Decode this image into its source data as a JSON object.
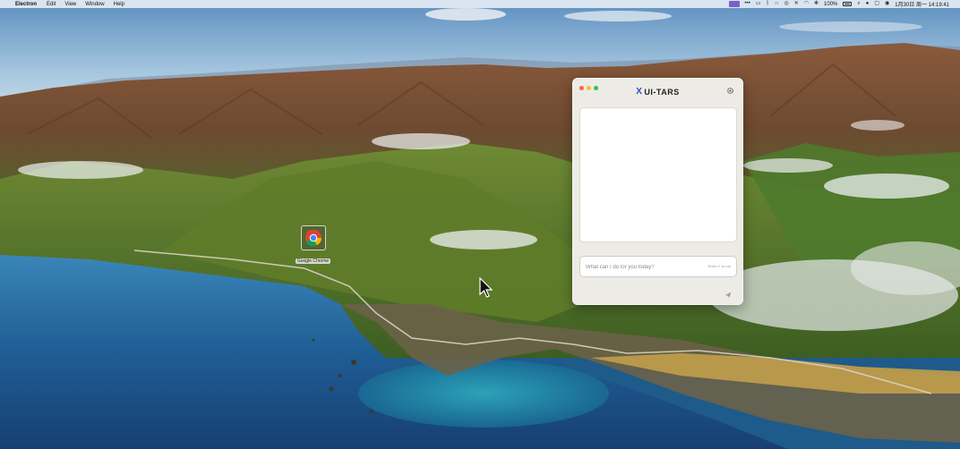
{
  "menubar": {
    "apple_glyph": "",
    "app_name": "Electron",
    "menus": [
      "Edit",
      "View",
      "Window",
      "Help"
    ],
    "status_items": {
      "battery_text": "100%",
      "datetime": "1月30日 周一  14:19:41"
    }
  },
  "desktop": {
    "icons": [
      {
        "label": "Google Chrome"
      }
    ]
  },
  "window": {
    "brand_name": "UI-TARS",
    "brand_mark": "X",
    "chat_placeholder": "What can I do for you today?",
    "input_hint": "Enter ↵ to run"
  },
  "colors": {
    "accent": "#2b4cd1",
    "close": "#ff5f57",
    "minimize": "#febc2e",
    "maximize": "#28c840",
    "tray_app": "#7b5fc9"
  },
  "icons": {
    "settings": "gear-icon",
    "send": "send-icon",
    "chrome": "chrome-icon"
  }
}
